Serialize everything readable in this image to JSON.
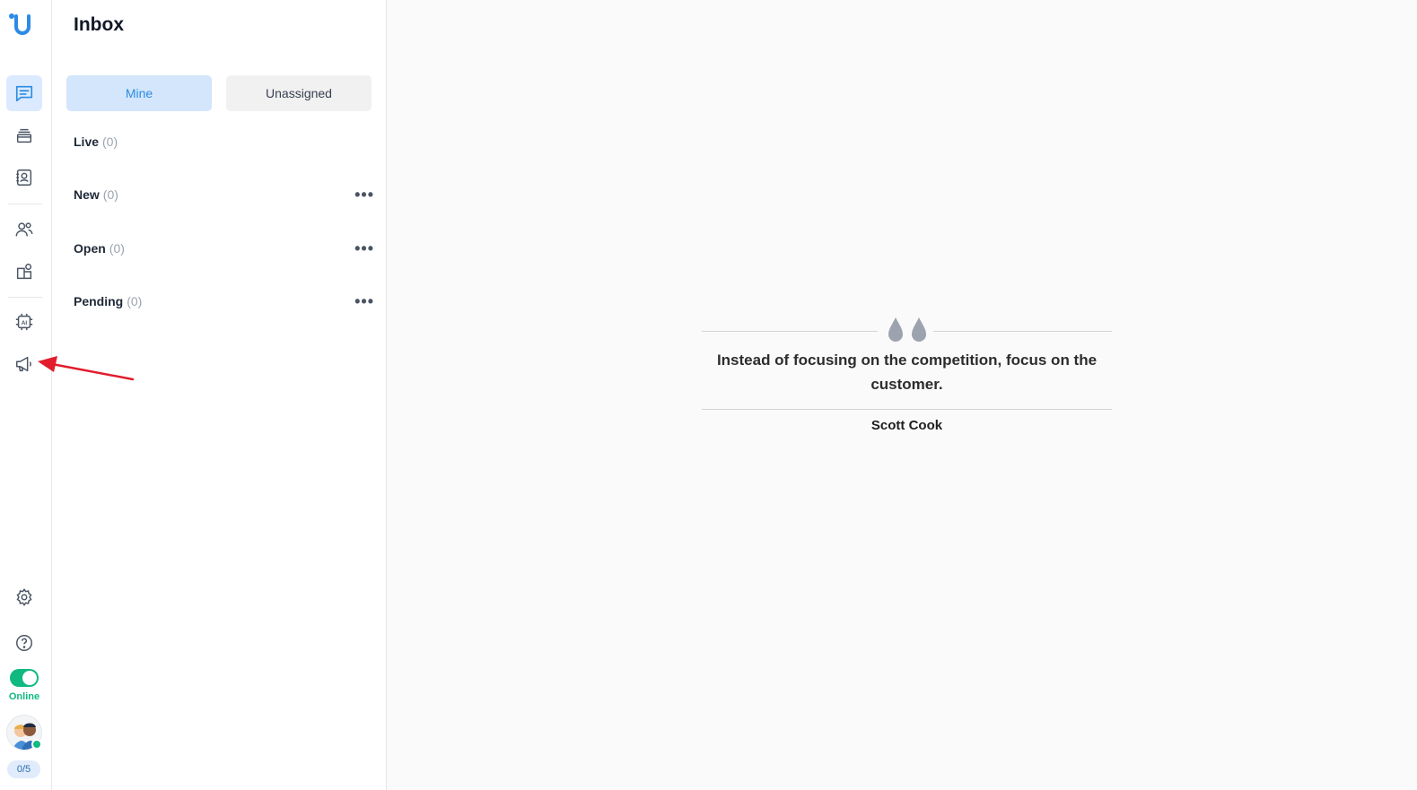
{
  "rail": {
    "items": [
      {
        "name": "conversations",
        "icon": "chat-icon",
        "active": true
      },
      {
        "name": "tickets",
        "icon": "layers-icon",
        "active": false
      },
      {
        "name": "contacts",
        "icon": "contact-book-icon",
        "active": false
      },
      {
        "name": "team",
        "icon": "users-icon",
        "active": false
      },
      {
        "name": "integrations",
        "icon": "apps-icon",
        "active": false
      },
      {
        "name": "ai",
        "icon": "ai-chip-icon",
        "active": false
      },
      {
        "name": "campaigns",
        "icon": "megaphone-icon",
        "active": false
      }
    ],
    "status_label": "Online",
    "capacity": "0/5",
    "accent_color": "#2c8be3",
    "online_color": "#10b981"
  },
  "inbox": {
    "title": "Inbox",
    "tabs": {
      "mine": "Mine",
      "unassigned": "Unassigned"
    },
    "folders": [
      {
        "name": "Live",
        "count": "(0)",
        "has_menu": false
      },
      {
        "name": "New",
        "count": "(0)",
        "has_menu": true
      },
      {
        "name": "Open",
        "count": "(0)",
        "has_menu": true
      },
      {
        "name": "Pending",
        "count": "(0)",
        "has_menu": true
      }
    ],
    "menu_glyph": "•••"
  },
  "quote": {
    "text": "Instead of focusing on the competition, focus on the customer.",
    "author": "Scott Cook"
  }
}
